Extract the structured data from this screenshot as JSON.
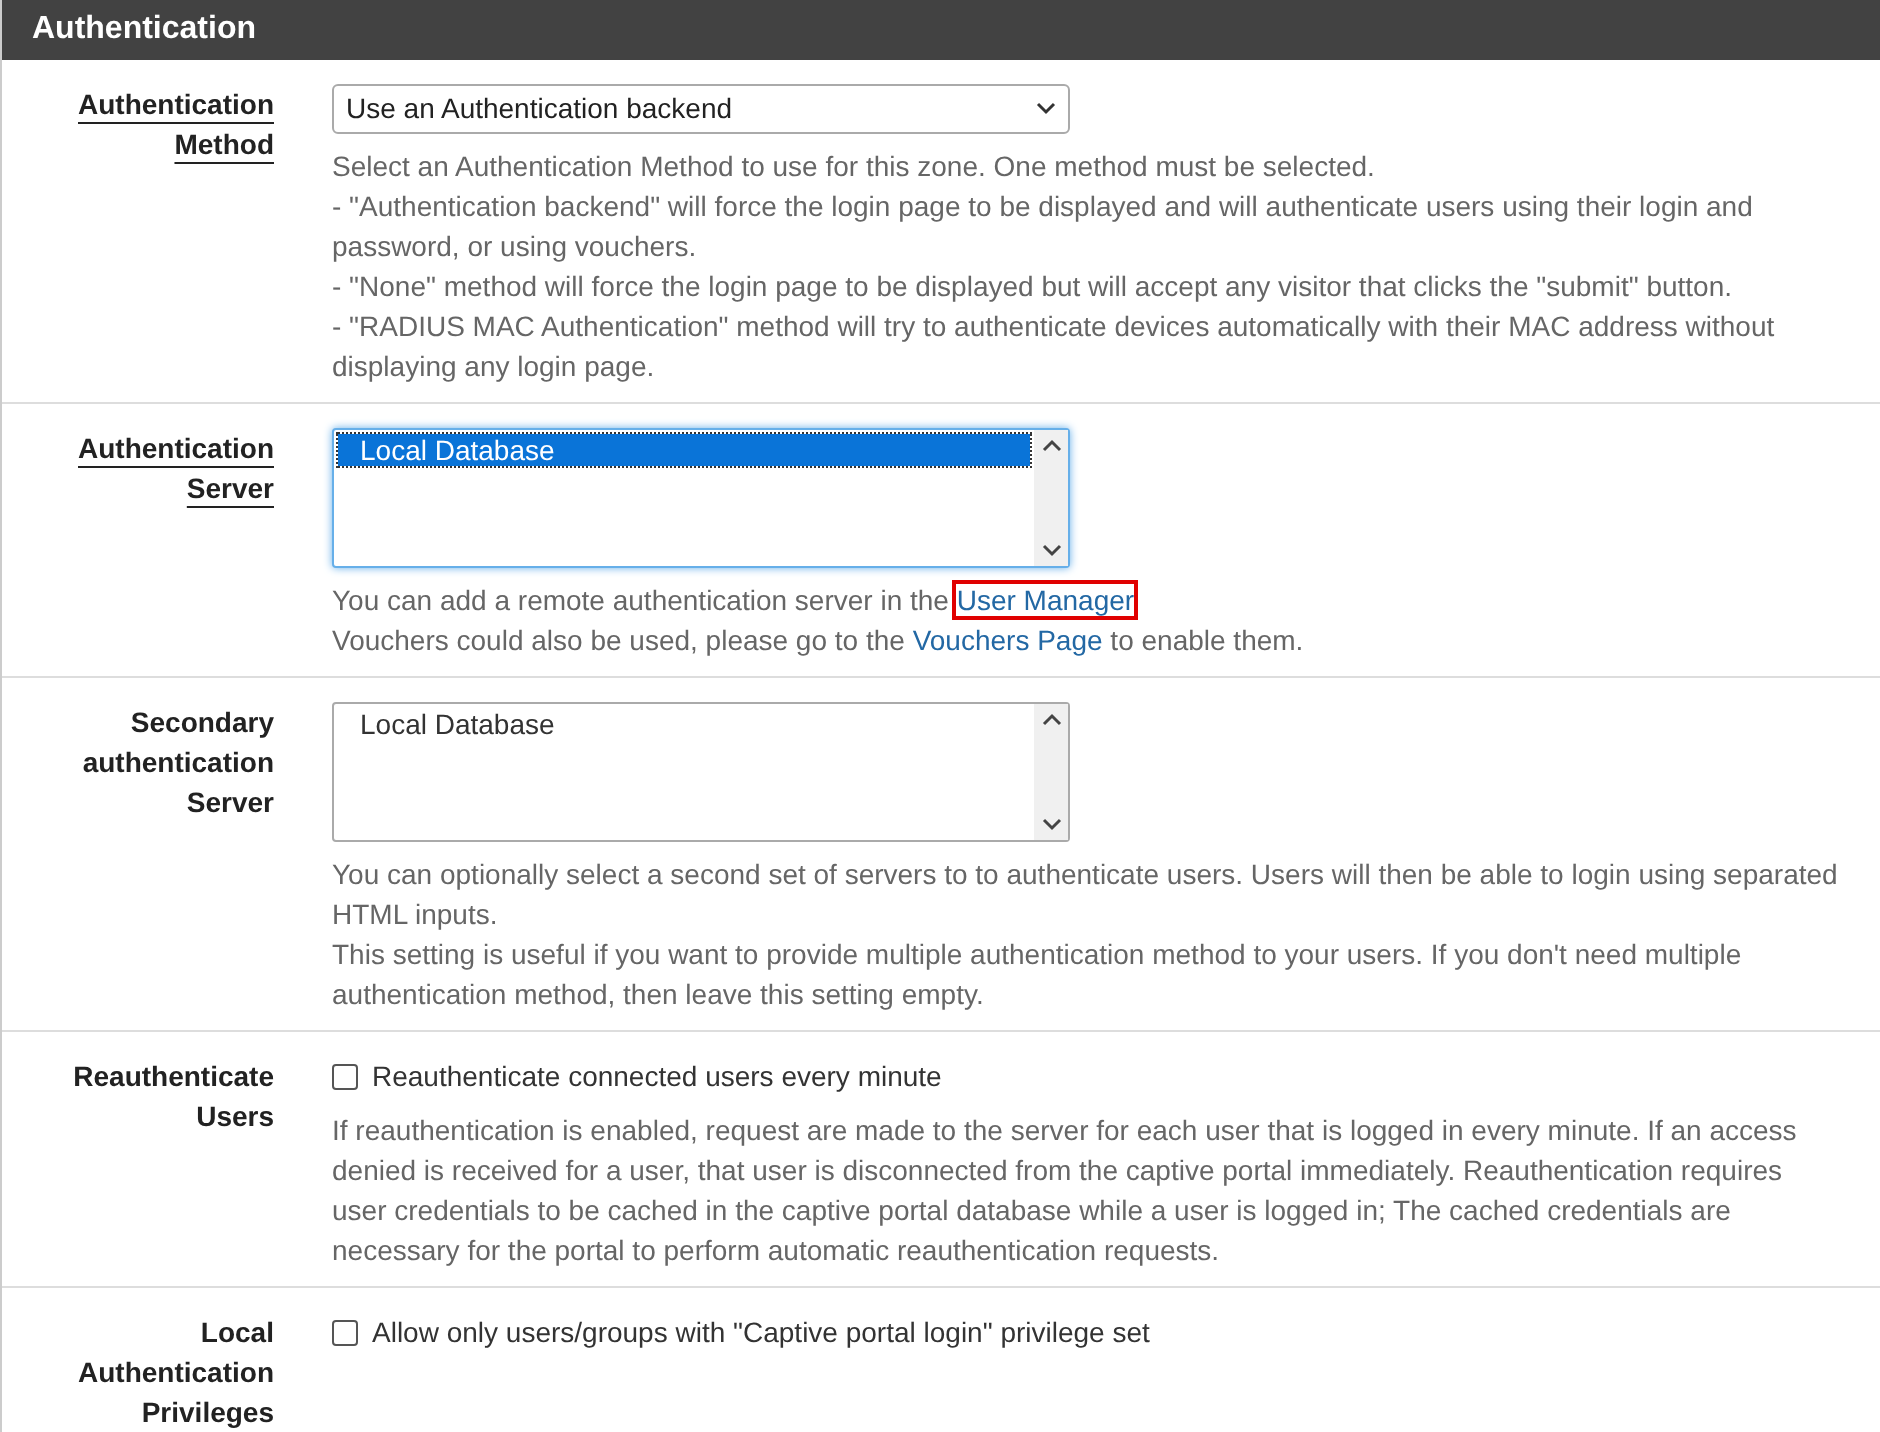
{
  "panel": {
    "title": "Authentication"
  },
  "rows": [
    {
      "kind": "select",
      "label": "Authentication Method",
      "underlined": true,
      "value": "Use an Authentication backend",
      "help": [
        {
          "parts": [
            {
              "text": "Select an Authentication Method to use for this zone. One method must be selected."
            }
          ]
        },
        {
          "parts": [
            {
              "text": "- \"Authentication backend\" will force the login page to be displayed and will authenticate users using their login and password, or using vouchers."
            }
          ]
        },
        {
          "parts": [
            {
              "text": "- \"None\" method will force the login page to be displayed but will accept any visitor that clicks the \"submit\" button."
            }
          ]
        },
        {
          "parts": [
            {
              "text": "- \"RADIUS MAC Authentication\" method will try to authenticate devices automatically with their MAC address without displaying any login page."
            }
          ]
        }
      ]
    },
    {
      "kind": "listbox",
      "label": "Authentication Server",
      "underlined": true,
      "focused": true,
      "options": [
        {
          "text": "Local Database",
          "selected": true
        }
      ],
      "help": [
        {
          "parts": [
            {
              "text": "You can add a remote authentication server in the "
            },
            {
              "text": "User Manager",
              "kind": "link",
              "highlighted": true
            }
          ]
        },
        {
          "parts": [
            {
              "text": "Vouchers could also be used, please go to the "
            },
            {
              "text": "Vouchers Page",
              "kind": "link",
              "highlighted": false
            },
            {
              "text": " to enable them."
            }
          ]
        }
      ]
    },
    {
      "kind": "listbox",
      "label": "Secondary authentication Server",
      "underlined": false,
      "focused": false,
      "options": [
        {
          "text": "Local Database",
          "selected": false
        }
      ],
      "help": [
        {
          "parts": [
            {
              "text": "You can optionally select a second set of servers to to authenticate users. Users will then be able to login using separated HTML inputs."
            }
          ]
        },
        {
          "parts": [
            {
              "text": "This setting is useful if you want to provide multiple authentication method to your users. If you don't need multiple authentication method, then leave this setting empty."
            }
          ]
        }
      ]
    },
    {
      "kind": "checkbox",
      "label": "Reauthenticate Users",
      "underlined": false,
      "checked": false,
      "caption": "Reauthenticate connected users every minute",
      "help": [
        {
          "parts": [
            {
              "text": "If reauthentication is enabled, request are made to the server for each user that is logged in every minute. If an access denied is received for a user, that user is disconnected from the captive portal immediately. Reauthentication requires user credentials to be cached in the captive portal database while a user is logged in; The cached credentials are necessary for the portal to perform automatic reauthentication requests."
            }
          ]
        }
      ]
    },
    {
      "kind": "checkbox",
      "label": "Local Authentication Privileges",
      "underlined": false,
      "checked": false,
      "caption": "Allow only users/groups with \"Captive portal login\" privilege set",
      "help": []
    }
  ]
}
